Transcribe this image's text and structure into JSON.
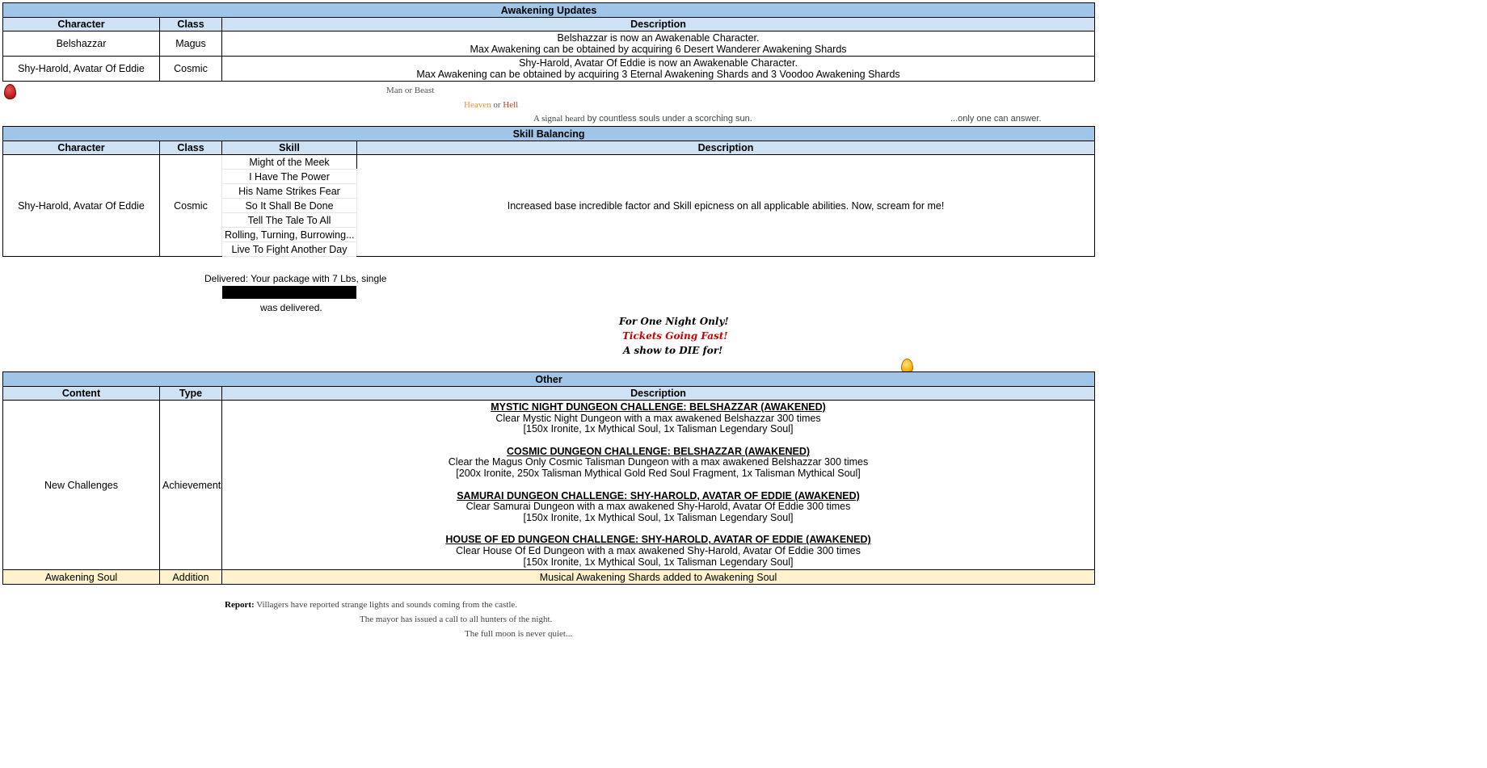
{
  "awakening": {
    "title": "Awakening Updates",
    "headers": [
      "Character",
      "Class",
      "Description"
    ],
    "rows": [
      {
        "character": "Belshazzar",
        "class": "Magus",
        "line1": "Belshazzar is now an Awakenable Character.",
        "line2": "Max Awakening can be obtained by acquiring 6 Desert Wanderer Awakening Shards"
      },
      {
        "character": "Shy-Harold, Avatar Of Eddie",
        "class": "Cosmic",
        "line1": "Shy-Harold, Avatar Of Eddie is now an Awakenable Character.",
        "line2": "Max Awakening can be obtained by acquiring 3 Eternal Awakening Shards and 3 Voodoo Awakening Shards"
      }
    ]
  },
  "hidden1": {
    "man_or_beast": "Man or Beast",
    "heaven": "Heaven",
    "or": " or ",
    "hell": "Hell",
    "signal_a": "A signal heard",
    "signal_b": " by countless souls under a scorching sun.",
    "answer": "...only one can answer."
  },
  "skills": {
    "title": "Skill Balancing",
    "headers": [
      "Character",
      "Class",
      "Skill",
      "Description"
    ],
    "character": "Shy-Harold, Avatar Of Eddie",
    "class": "Cosmic",
    "skill_list": [
      "Might of the Meek",
      "I Have The Power",
      "His Name Strikes Fear",
      "So It Shall Be Done",
      "Tell The Tale To All",
      "Rolling, Turning, Burrowing...",
      "Live To Fight Another Day"
    ],
    "description": "Increased base incredible factor and Skill epicness on all applicable abilities. Now, scream for me!"
  },
  "delivery": {
    "line1": "Delivered: Your package with 7 Lbs, single",
    "line2": "was delivered."
  },
  "show": {
    "line1": "For One Night Only!",
    "line2": "Tickets Going Fast!",
    "line3": "A show to DIE for!"
  },
  "other": {
    "title": "Other",
    "headers": [
      "Content",
      "Type",
      "Description"
    ],
    "content": "New Challenges",
    "type": "Achievements",
    "challenges": [
      {
        "title": "MYSTIC NIGHT DUNGEON CHALLENGE: BELSHAZZAR (AWAKENED)",
        "line": "Clear Mystic Night Dungeon with a max awakened Belshazzar 300 times",
        "reward": "[150x Ironite, 1x Mythical Soul, 1x Talisman Legendary Soul]"
      },
      {
        "title": "COSMIC DUNGEON CHALLENGE: BELSHAZZAR (AWAKENED)",
        "line": "Clear the Magus Only Cosmic Talisman Dungeon with a max awakened Belshazzar 300 times",
        "reward": "[200x Ironite, 250x Talisman Mythical Gold Red Soul Fragment, 1x Talisman Mythical Soul]"
      },
      {
        "title": "SAMURAI DUNGEON CHALLENGE: SHY-HAROLD, AVATAR OF EDDIE (AWAKENED)",
        "line": "Clear Samurai Dungeon with a max awakened Shy-Harold, Avatar Of Eddie 300 times",
        "reward": "[150x Ironite, 1x Mythical Soul, 1x Talisman Legendary Soul]"
      },
      {
        "title": "HOUSE OF ED DUNGEON CHALLENGE: SHY-HAROLD, AVATAR OF EDDIE (AWAKENED)",
        "line": "Clear House Of Ed Dungeon with a max awakened Shy-Harold, Avatar Of Eddie 300 times",
        "reward": "[150x Ironite, 1x Mythical Soul, 1x Talisman Legendary Soul]"
      }
    ],
    "soul_content": "Awakening Soul",
    "soul_type": "Addition",
    "soul_description": "Musical Awakening Shards added to Awakening Soul"
  },
  "report": {
    "label": "Report:",
    "line1": " Villagers have reported strange lights and sounds coming from the castle.",
    "line2": "The mayor has issued a call to all hunters of the night.",
    "line3": "The full moon is never quiet..."
  },
  "colors": {
    "title_blue": "#9fc5e8",
    "header_blue": "#cfe2f3",
    "cream": "#fff2cc",
    "heaven_orange": "#e69138",
    "tickets_red": "#cc0000",
    "egg_red": "#c62828",
    "egg_yellow": "#f4b400"
  }
}
